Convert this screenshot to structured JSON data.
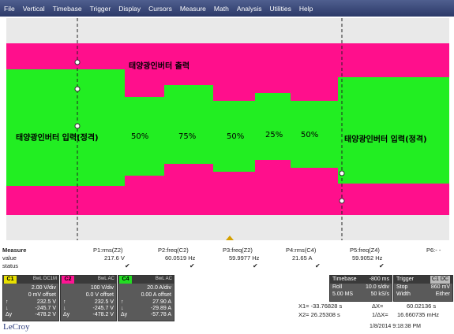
{
  "menu": [
    "File",
    "Vertical",
    "Timebase",
    "Trigger",
    "Display",
    "Cursors",
    "Measure",
    "Math",
    "Analysis",
    "Utilities",
    "Help"
  ],
  "overlay": {
    "output_label": "태양광인버터 출력",
    "input_left": "태양광인버터 입력(정격)",
    "input_right": "태양광인버터 입력(정격)",
    "steps": [
      "50%",
      "75%",
      "50%",
      "25%",
      "50%"
    ]
  },
  "measure": {
    "row_labels": [
      "Measure",
      "value",
      "status"
    ],
    "params": [
      {
        "name": "P1:rms(Z2)",
        "value": "217.6 V",
        "status": "✔"
      },
      {
        "name": "P2:freq(C2)",
        "value": "60.0519 Hz",
        "status": "✔"
      },
      {
        "name": "P3:freq(Z2)",
        "value": "59.9977 Hz",
        "status": "✔"
      },
      {
        "name": "P4:rms(C4)",
        "value": "21.65 A",
        "status": "✔"
      },
      {
        "name": "P5:freq(Z4)",
        "value": "59.9052 Hz",
        "status": "✔"
      },
      {
        "name": "P6:- -",
        "value": "",
        "status": ""
      }
    ]
  },
  "channels": [
    {
      "tag": "C1",
      "coupling": "BwL DC1M",
      "color": "#e8e000",
      "scale": "2.00 V/div",
      "offset": "0 mV offset",
      "up": "232.5 V",
      "down": "-245.7 V",
      "delta": "-478.2 V"
    },
    {
      "tag": "C2",
      "coupling": "BwL AC",
      "color": "#ff1493",
      "scale": "100 V/div",
      "offset": "0.0 V offset",
      "up": "232.5 V",
      "down": "-245.7 V",
      "delta": "-478.2 V"
    },
    {
      "tag": "C4",
      "coupling": "BwL AC",
      "color": "#22dd22",
      "scale": "20.0 A/div",
      "offset": "0.00 A offset",
      "up": "27.90 A",
      "down": "-29.89 A",
      "delta": "-57.78 A"
    }
  ],
  "timebase": {
    "label": "Timebase",
    "delay": "-800 ms",
    "mode": "Roll",
    "tdiv": "10.0 s/div",
    "samples": "5.00 MS",
    "rate": "50 kS/s"
  },
  "trigger": {
    "label": "Trigger",
    "chip": "C1 DC",
    "stop": "Stop",
    "level": "860 mV",
    "width": "Width",
    "edge": "Either"
  },
  "cursor_readout": {
    "x1": "X1= -33.76828 s",
    "dx": "ΔX=",
    "dxv": "60.02136 s",
    "x2": "X2= 26.25308 s",
    "inv": "1/ΔX=",
    "invv": "16.660735 mHz"
  },
  "brand": "LeCroy",
  "timestamp": "1/8/2014 9:18:38 PM",
  "colors": {
    "magenta": "#ff0f8c",
    "green": "#22ee22",
    "bg": "#e9e9e9"
  }
}
